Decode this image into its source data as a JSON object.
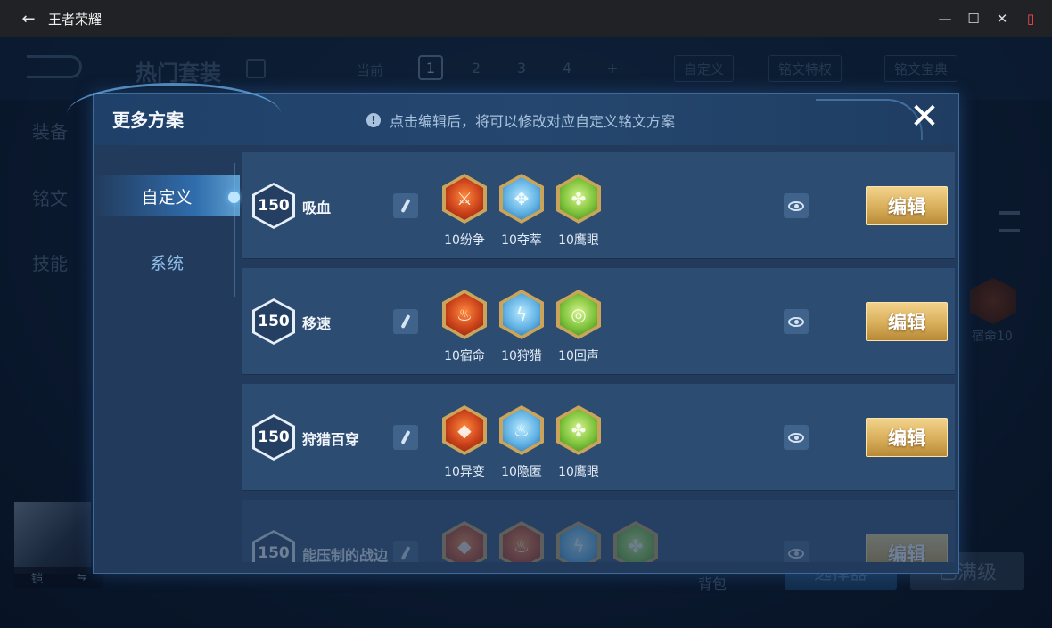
{
  "window": {
    "title": "王者荣耀",
    "back_glyph": "←",
    "minimize_glyph": "—",
    "maximize_glyph": "☐",
    "close_glyph": "✕",
    "sidebar_glyph": "▯"
  },
  "background": {
    "title": "热门套装",
    "current_label": "当前",
    "pages": [
      "1",
      "2",
      "3",
      "4",
      "+"
    ],
    "tabs": [
      "自定义",
      "铭文特权",
      "铭文宝典"
    ],
    "side_items": [
      "装备",
      "铭文",
      "技能"
    ],
    "rune_label": "宿命10",
    "avatar_left": "铠",
    "avatar_right": "⇋",
    "bag_label": "背包",
    "btn_select": "选择器",
    "btn_full": "已满级"
  },
  "modal": {
    "title": "更多方案",
    "hint_icon": "!",
    "hint": "点击编辑后，将可以修改对应自定义铭文方案",
    "close_glyph": "✕",
    "tabs": [
      {
        "label": "自定义",
        "active": true
      },
      {
        "label": "系统",
        "active": false
      }
    ],
    "edit_label": "编辑",
    "schemes": [
      {
        "level": "150",
        "name": "吸血",
        "runes": [
          {
            "label": "10纷争",
            "color": "red",
            "icon": "axe-icon"
          },
          {
            "label": "10夺萃",
            "color": "blue",
            "icon": "triquetra-icon"
          },
          {
            "label": "10鹰眼",
            "color": "green",
            "icon": "clover-icon"
          }
        ]
      },
      {
        "level": "150",
        "name": "移速",
        "runes": [
          {
            "label": "10宿命",
            "color": "red",
            "icon": "flame-icon"
          },
          {
            "label": "10狩猎",
            "color": "blue",
            "icon": "lightning-icon"
          },
          {
            "label": "10回声",
            "color": "green",
            "icon": "ring-icon"
          }
        ]
      },
      {
        "level": "150",
        "name": "狩猎百穿",
        "runes": [
          {
            "label": "10异变",
            "color": "red",
            "icon": "gem-icon"
          },
          {
            "label": "10隐匿",
            "color": "blue",
            "icon": "flame-icon"
          },
          {
            "label": "10鹰眼",
            "color": "green",
            "icon": "clover-icon"
          }
        ]
      },
      {
        "level": "150",
        "name": "能压制的战边",
        "runes": [
          {
            "label": "",
            "color": "red",
            "icon": "gem-icon"
          },
          {
            "label": "",
            "color": "red",
            "icon": "flame-icon"
          },
          {
            "label": "",
            "color": "blue",
            "icon": "lightning-icon"
          },
          {
            "label": "",
            "color": "green",
            "icon": "clover-icon"
          }
        ]
      }
    ]
  },
  "colors": {
    "edit_button_gold": "#d8ae5a",
    "rune_frame_gold": "#c9a45a",
    "modal_bg": "#223b5c"
  }
}
